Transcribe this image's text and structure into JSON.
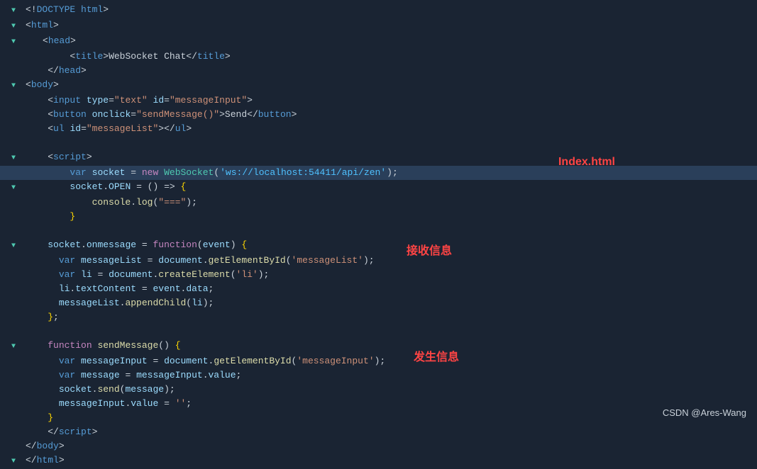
{
  "editor": {
    "background": "#1a2433",
    "lines": [
      {
        "num": "",
        "content": "doctype",
        "type": "doctype"
      },
      {
        "num": "",
        "content": "html_open",
        "type": "html_open"
      },
      {
        "num": "",
        "content": "head_open",
        "type": "head_open"
      },
      {
        "num": "",
        "content": "title",
        "type": "title"
      },
      {
        "num": "",
        "content": "head_close",
        "type": "head_close"
      },
      {
        "num": "",
        "content": "body_open",
        "type": "body_open"
      },
      {
        "num": "",
        "content": "input",
        "type": "input_tag"
      },
      {
        "num": "",
        "content": "button",
        "type": "button_tag"
      },
      {
        "num": "",
        "content": "ul",
        "type": "ul_tag"
      },
      {
        "num": "",
        "content": "blank",
        "type": "blank"
      },
      {
        "num": "",
        "content": "script_open",
        "type": "script_open"
      },
      {
        "num": "",
        "content": "websocket",
        "type": "websocket"
      },
      {
        "num": "",
        "content": "socket_open",
        "type": "socket_open"
      },
      {
        "num": "",
        "content": "console",
        "type": "console"
      },
      {
        "num": "",
        "content": "close_brace",
        "type": "close_brace"
      },
      {
        "num": "",
        "content": "blank",
        "type": "blank"
      },
      {
        "num": "",
        "content": "onmessage",
        "type": "onmessage"
      },
      {
        "num": "",
        "content": "messagelist",
        "type": "messagelist"
      },
      {
        "num": "",
        "content": "li",
        "type": "li"
      },
      {
        "num": "",
        "content": "textcontent",
        "type": "textcontent"
      },
      {
        "num": "",
        "content": "appendchild",
        "type": "appendchild"
      },
      {
        "num": "",
        "content": "close_brace2",
        "type": "close_brace2"
      },
      {
        "num": "",
        "content": "blank",
        "type": "blank"
      },
      {
        "num": "",
        "content": "function_send",
        "type": "function_send"
      },
      {
        "num": "",
        "content": "messageinput",
        "type": "messageinput"
      },
      {
        "num": "",
        "content": "message",
        "type": "message"
      },
      {
        "num": "",
        "content": "socket_send",
        "type": "socket_send"
      },
      {
        "num": "",
        "content": "messageinput_value",
        "type": "messageinput_value"
      },
      {
        "num": "",
        "content": "close_brace3",
        "type": "close_brace3"
      },
      {
        "num": "",
        "content": "script_close",
        "type": "script_close"
      },
      {
        "num": "",
        "content": "body_close",
        "type": "body_close"
      },
      {
        "num": "",
        "content": "html_close",
        "type": "html_close"
      }
    ]
  },
  "annotations": {
    "index": "Index.html",
    "receive": "接收信息",
    "send": "发生信息"
  },
  "watermark": "CSDN @Ares-Wang"
}
